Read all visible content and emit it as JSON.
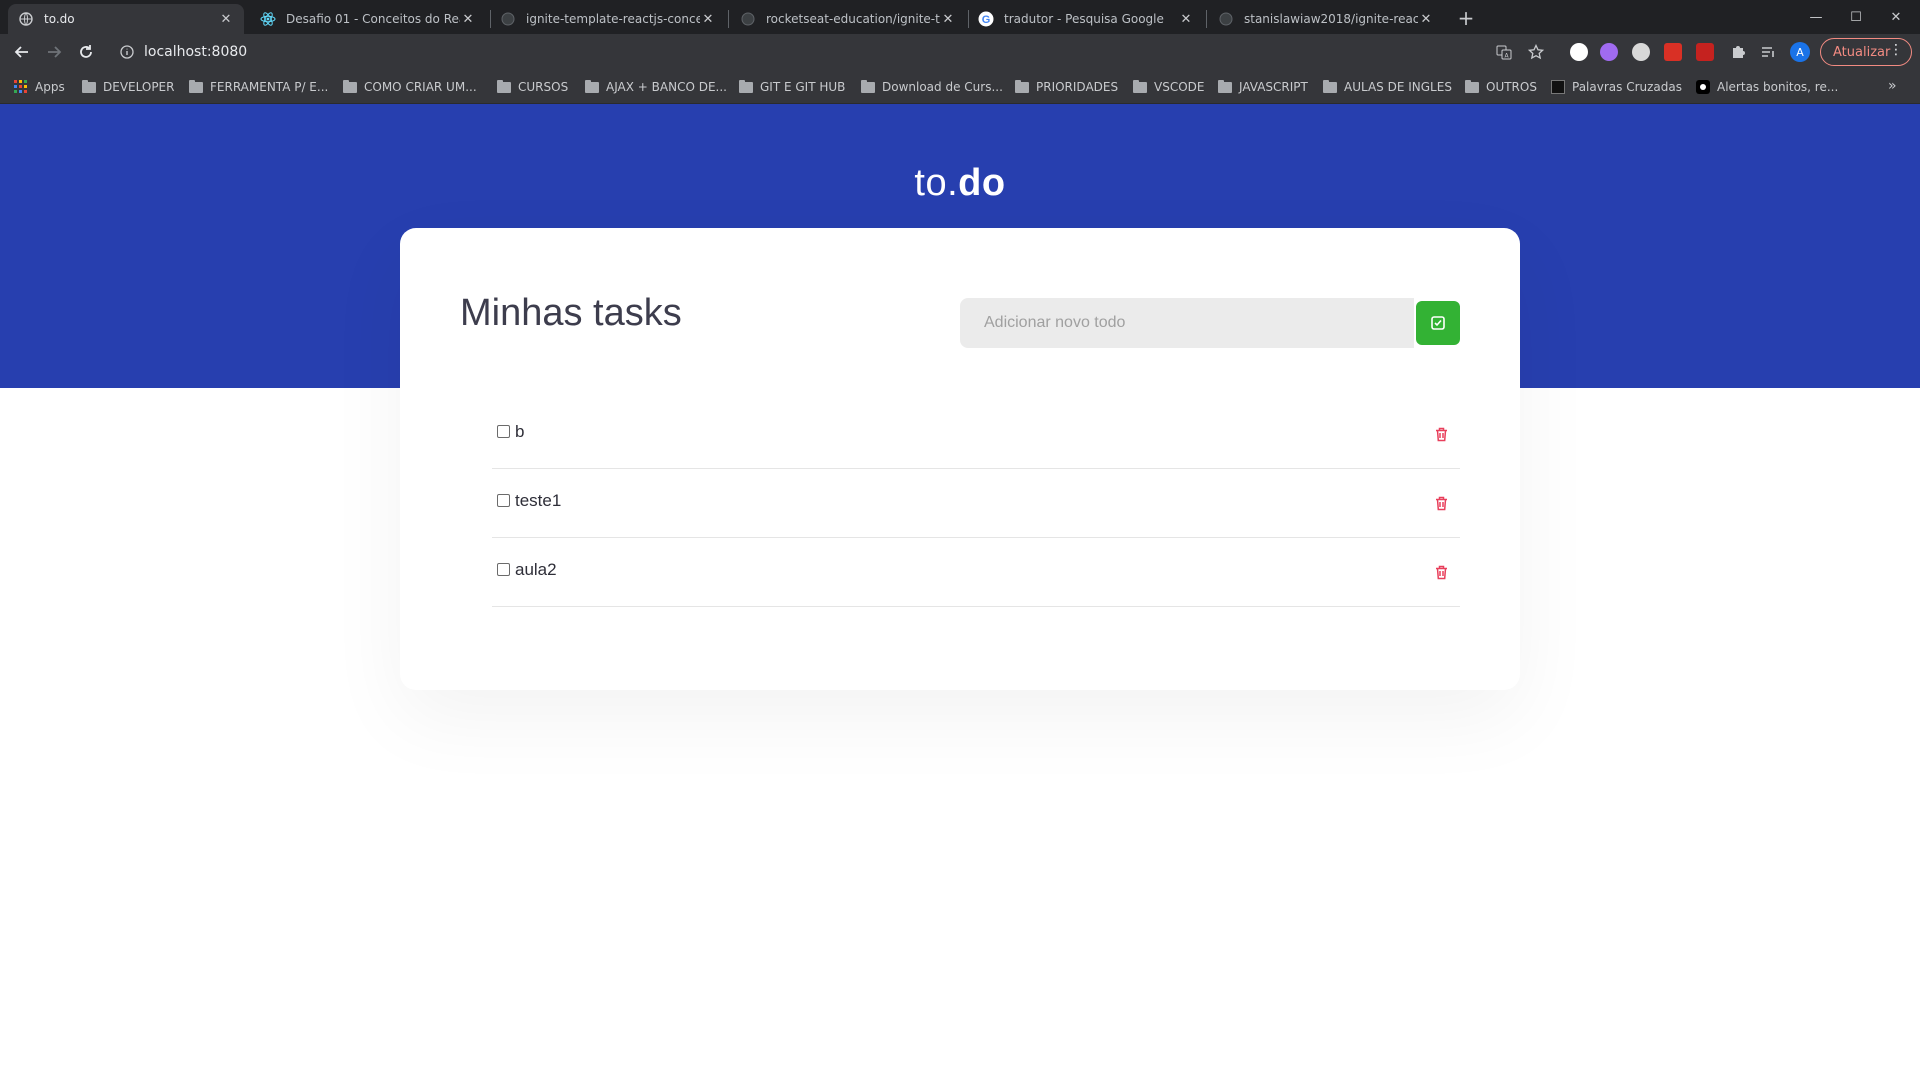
{
  "browser": {
    "tabs": [
      {
        "label": "to.do",
        "active": true,
        "icon": "globe-icon"
      },
      {
        "label": "Desafio 01 - Conceitos do React",
        "active": false,
        "icon": "react-icon"
      },
      {
        "label": "ignite-template-reactjs-conceito",
        "active": false,
        "icon": "github-icon"
      },
      {
        "label": "rocketseat-education/ignite-te",
        "active": false,
        "icon": "github-icon"
      },
      {
        "label": "tradutor - Pesquisa Google",
        "active": false,
        "icon": "google-icon"
      },
      {
        "label": "stanislawiaw2018/ignite-reactjs",
        "active": false,
        "icon": "github-icon"
      }
    ],
    "address": "localhost:8080",
    "update_label": "Atualizar",
    "bookmarks": [
      {
        "label": "Apps",
        "type": "apps"
      },
      {
        "label": "DEVELOPER",
        "type": "folder"
      },
      {
        "label": "FERRAMENTA P/ E...",
        "type": "folder"
      },
      {
        "label": "COMO CRIAR UM...",
        "type": "folder"
      },
      {
        "label": "CURSOS",
        "type": "folder"
      },
      {
        "label": "AJAX + BANCO DE...",
        "type": "folder"
      },
      {
        "label": "GIT E GIT HUB",
        "type": "folder"
      },
      {
        "label": "Download de Curs...",
        "type": "folder"
      },
      {
        "label": "PRIORIDADES",
        "type": "folder"
      },
      {
        "label": "VSCODE",
        "type": "folder"
      },
      {
        "label": "JAVASCRIPT",
        "type": "folder"
      },
      {
        "label": "AULAS DE INGLES",
        "type": "folder"
      },
      {
        "label": "OUTROS",
        "type": "folder"
      },
      {
        "label": "Palavras Cruzadas",
        "type": "site"
      },
      {
        "label": "Alertas bonitos, re...",
        "type": "site"
      }
    ],
    "more_label": "»"
  },
  "app": {
    "logo_light": "to.",
    "logo_bold": "do",
    "title": "Minhas tasks",
    "input_placeholder": "Adicionar novo todo",
    "tasks": [
      {
        "title": "b",
        "done": false
      },
      {
        "title": "teste1",
        "done": false
      },
      {
        "title": "aula2",
        "done": false
      }
    ]
  },
  "colors": {
    "header_blue": "#273faf",
    "add_green": "#33b234",
    "trash_red": "#e83f5b"
  }
}
